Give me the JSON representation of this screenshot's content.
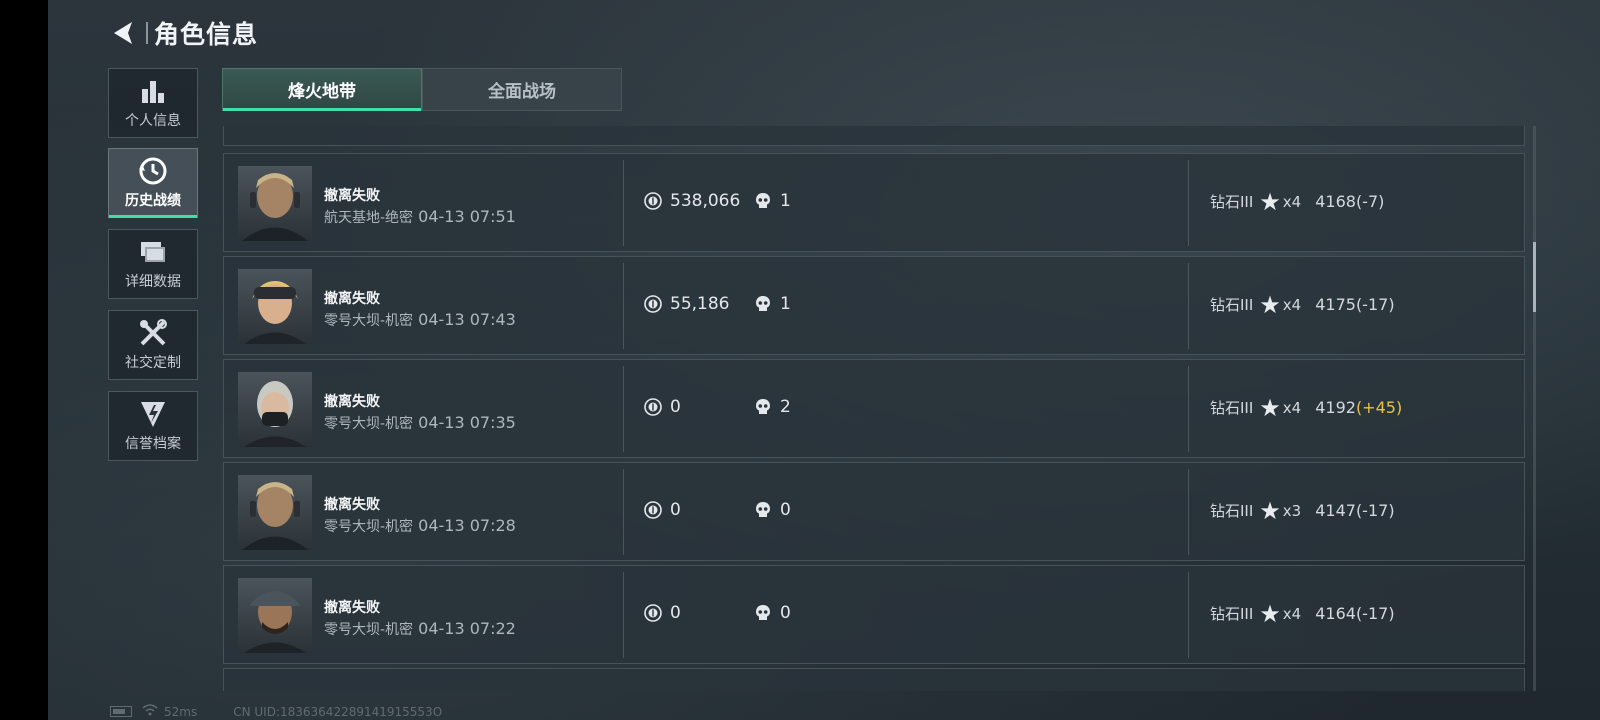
{
  "header": {
    "title": "角色信息"
  },
  "nav": [
    {
      "label": "个人信息",
      "icon": "bar-chart-icon"
    },
    {
      "label": "历史战绩",
      "icon": "history-icon",
      "active": true
    },
    {
      "label": "详细数据",
      "icon": "folder-icon"
    },
    {
      "label": "社交定制",
      "icon": "tools-icon"
    },
    {
      "label": "信誉档案",
      "icon": "shield-bolt-icon"
    }
  ],
  "tabs": [
    {
      "label": "烽火地带",
      "active": true
    },
    {
      "label": "全面战场"
    }
  ],
  "matches": [
    {
      "result": "撤离失败",
      "map": "航天基地-绝密",
      "time": "04-13 07:51",
      "money": "538,066",
      "kills": "1",
      "rank": "钻石III",
      "stars": "x4",
      "score": "4168",
      "delta": "(-7)",
      "delta_positive": false
    },
    {
      "result": "撤离失败",
      "map": "零号大坝-机密",
      "time": "04-13 07:43",
      "money": "55,186",
      "kills": "1",
      "rank": "钻石III",
      "stars": "x4",
      "score": "4175",
      "delta": "(-17)",
      "delta_positive": false
    },
    {
      "result": "撤离失败",
      "map": "零号大坝-机密",
      "time": "04-13 07:35",
      "money": "0",
      "kills": "2",
      "rank": "钻石III",
      "stars": "x4",
      "score": "4192",
      "delta": "(+45)",
      "delta_positive": true
    },
    {
      "result": "撤离失败",
      "map": "零号大坝-机密",
      "time": "04-13 07:28",
      "money": "0",
      "kills": "0",
      "rank": "钻石III",
      "stars": "x3",
      "score": "4147",
      "delta": "(-17)",
      "delta_positive": false
    },
    {
      "result": "撤离失败",
      "map": "零号大坝-机密",
      "time": "04-13 07:22",
      "money": "0",
      "kills": "0",
      "rank": "钻石III",
      "stars": "x4",
      "score": "4164",
      "delta": "(-17)",
      "delta_positive": false
    }
  ],
  "status": {
    "ping": "52ms",
    "uid": "CN UID:18363642289141915553O"
  },
  "colors": {
    "accent": "#3ee0a8",
    "positive_delta": "#e8c545",
    "background": "#253037"
  }
}
